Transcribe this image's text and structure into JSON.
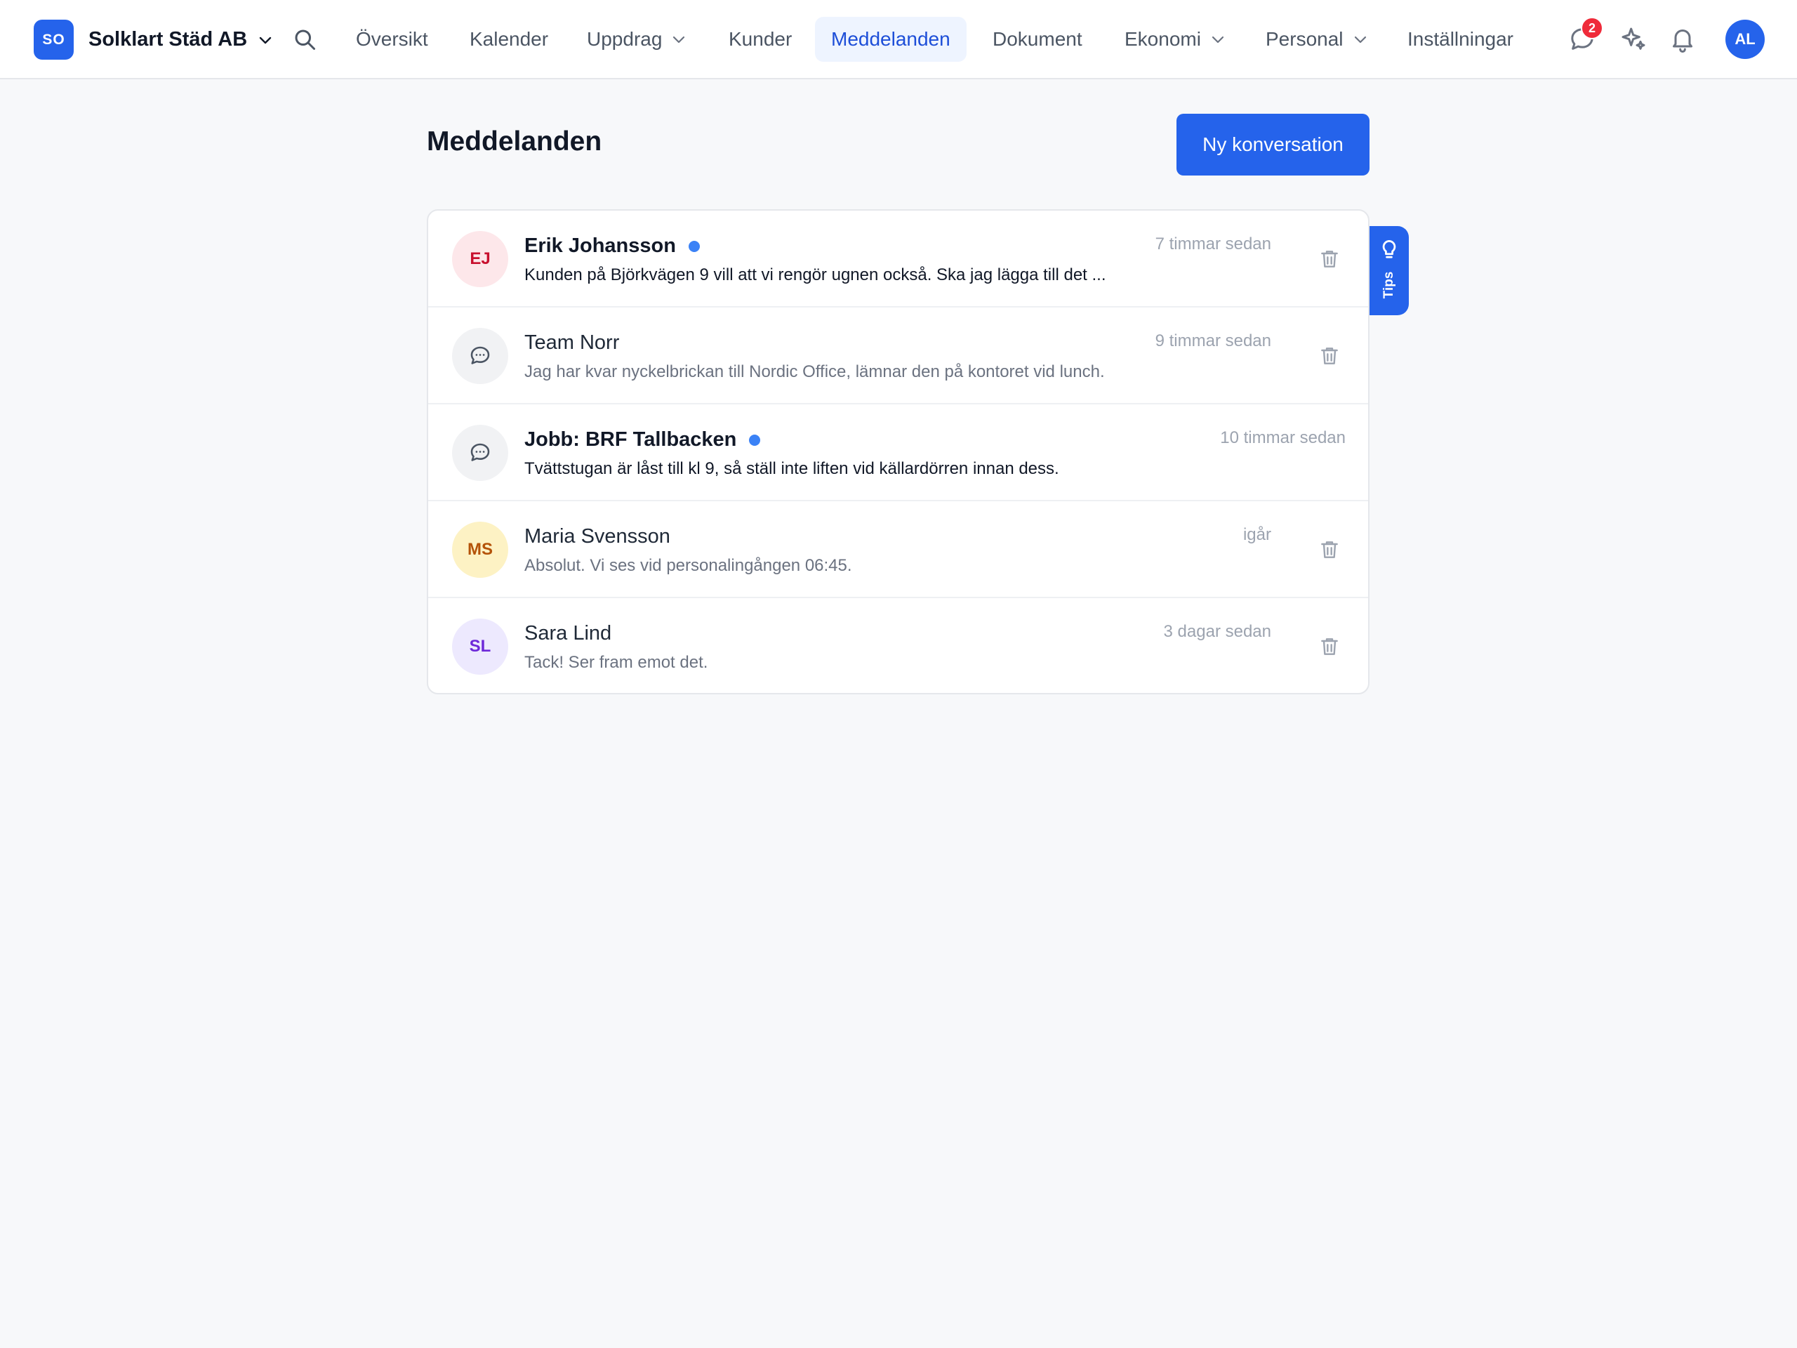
{
  "app": {
    "company_initials": "SO",
    "company_name": "Solklart Städ AB",
    "user_initials": "AL",
    "message_badge_count": "2",
    "accent_color": "#2563eb"
  },
  "nav": {
    "items": [
      {
        "label": "Översikt",
        "dropdown": false
      },
      {
        "label": "Kalender",
        "dropdown": false
      },
      {
        "label": "Uppdrag",
        "dropdown": true
      },
      {
        "label": "Kunder",
        "dropdown": false
      },
      {
        "label": "Meddelanden",
        "dropdown": false,
        "active": true
      },
      {
        "label": "Dokument",
        "dropdown": false
      },
      {
        "label": "Ekonomi",
        "dropdown": true
      },
      {
        "label": "Personal",
        "dropdown": true
      },
      {
        "label": "Inställningar",
        "dropdown": false
      }
    ],
    "icons": [
      "search-icon",
      "chat-icon",
      "sparkle-icon",
      "bell-icon"
    ]
  },
  "page": {
    "title": "Meddelanden",
    "new_conversation_label": "Ny konversation"
  },
  "conversations": [
    {
      "avatar_initials": "EJ",
      "avatar_icon": null,
      "avatar_bg": "#fde7ea",
      "avatar_fg": "#c8102e",
      "name": "Erik Johansson",
      "unread": true,
      "preview": "Kunden på Björkvägen 9 vill att vi rengör ugnen också. Ska jag lägga till det ...",
      "time": "7 timmar sedan",
      "deletable": true
    },
    {
      "avatar_initials": "",
      "avatar_icon": "chat-bubble-icon",
      "avatar_bg": "#f1f2f4",
      "avatar_fg": "#4b5563",
      "name": "Team Norr",
      "unread": false,
      "preview": "Jag har kvar nyckelbrickan till Nordic Office, lämnar den på kontoret vid lunch.",
      "time": "9 timmar sedan",
      "deletable": true
    },
    {
      "avatar_initials": "",
      "avatar_icon": "chat-bubble-icon",
      "avatar_bg": "#f1f2f4",
      "avatar_fg": "#4b5563",
      "name": "Jobb: BRF Tallbacken",
      "unread": true,
      "preview": "Tvättstugan är låst till kl 9, så ställ inte liften vid källardörren innan dess.",
      "time": "10 timmar sedan",
      "deletable": false
    },
    {
      "avatar_initials": "MS",
      "avatar_icon": null,
      "avatar_bg": "#fdf2c4",
      "avatar_fg": "#b45309",
      "name": "Maria Svensson",
      "unread": false,
      "preview": "Absolut. Vi ses vid personalingången 06:45.",
      "time": "igår",
      "deletable": true
    },
    {
      "avatar_initials": "SL",
      "avatar_icon": null,
      "avatar_bg": "#ede9fe",
      "avatar_fg": "#6d28d9",
      "name": "Sara Lind",
      "unread": false,
      "preview": "Tack! Ser fram emot det.",
      "time": "3 dagar sedan",
      "deletable": true
    }
  ],
  "tips": {
    "label": "Tips",
    "icon": "lightbulb-icon"
  }
}
